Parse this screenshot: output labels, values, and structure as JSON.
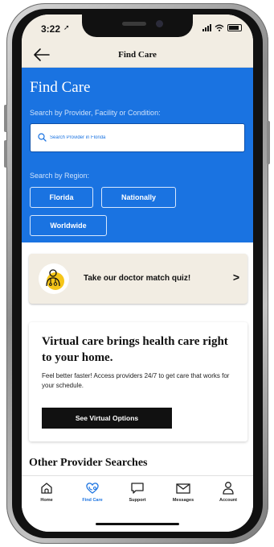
{
  "status_bar": {
    "time": "3:22"
  },
  "nav": {
    "title": "Find Care",
    "back_icon": "back-arrow-icon"
  },
  "hero": {
    "title": "Find Care",
    "search_label": "Search by Provider, Facility or Condition:",
    "search_placeholder": "Search Provider in Florida",
    "region_label": "Search by Region:",
    "regions": [
      "Florida",
      "Nationally",
      "Worldwide"
    ]
  },
  "quiz": {
    "text": "Take our doctor match quiz!",
    "chevron": ">"
  },
  "virtual_care": {
    "title": "Virtual care brings health care right to your home.",
    "body": "Feel better faster! Access providers 24/7 to get care that works for your schedule.",
    "button": "See Virtual Options"
  },
  "other": {
    "title": "Other Provider Searches"
  },
  "tabs": [
    {
      "label": "Home",
      "icon": "home-icon",
      "active": false
    },
    {
      "label": "Find Care",
      "icon": "heart-stethoscope-icon",
      "active": true
    },
    {
      "label": "Support",
      "icon": "chat-bubble-icon",
      "active": false
    },
    {
      "label": "Messages",
      "icon": "envelope-icon",
      "active": false
    },
    {
      "label": "Account",
      "icon": "person-icon",
      "active": false
    }
  ],
  "colors": {
    "brand_blue": "#1a73e1",
    "cream": "#f2ede3",
    "accent_yellow": "#f5c518"
  }
}
